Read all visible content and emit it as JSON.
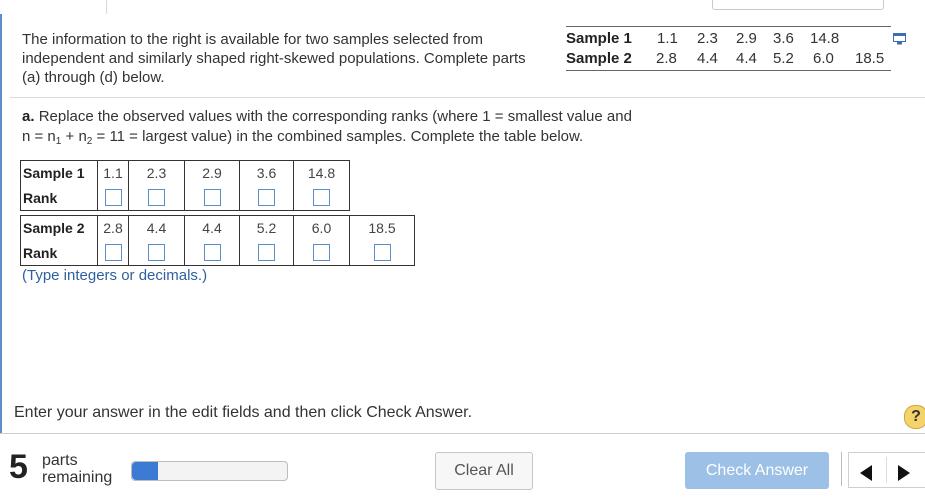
{
  "intro": {
    "text": "The information to the right is available for two samples selected from independent and similarly shaped right-skewed populations. Complete parts (a) through (d) below."
  },
  "given": {
    "sample1_label": "Sample 1",
    "sample2_label": "Sample 2",
    "sample1_values": [
      "1.1",
      "2.3",
      "2.9",
      "3.6",
      "14.8"
    ],
    "sample2_values": [
      "2.8",
      "4.4",
      "4.4",
      "5.2",
      "6.0",
      "18.5"
    ]
  },
  "part_a": {
    "label": "a.",
    "line1": "Replace the observed values with the corresponding ranks (where 1 = smallest value and",
    "n_text": "n = n",
    "sub1": "1",
    "plus": " + n",
    "sub2": "2",
    "rest": " = 11 = largest value)  in the combined samples. Complete the table below."
  },
  "table1": {
    "row1_label": "Sample 1",
    "row2_label": "Rank",
    "values": [
      "1.1",
      "2.3",
      "2.9",
      "3.6",
      "14.8"
    ]
  },
  "table2": {
    "row1_label": "Sample 2",
    "row2_label": "Rank",
    "values": [
      "2.8",
      "4.4",
      "4.4",
      "5.2",
      "6.0",
      "18.5"
    ]
  },
  "hint": "(Type integers or decimals.)",
  "footer": {
    "instruction": "Enter your answer in the edit fields and then click Check Answer.",
    "help_symbol": "?",
    "parts_count": "5",
    "parts_word1": "parts",
    "parts_word2": "remaining",
    "progress_fraction": 0.17,
    "clear_label": "Clear All",
    "check_label": "Check Answer"
  },
  "icons": [
    "copy-icon",
    "help-icon",
    "prev-arrow-icon",
    "next-arrow-icon"
  ]
}
